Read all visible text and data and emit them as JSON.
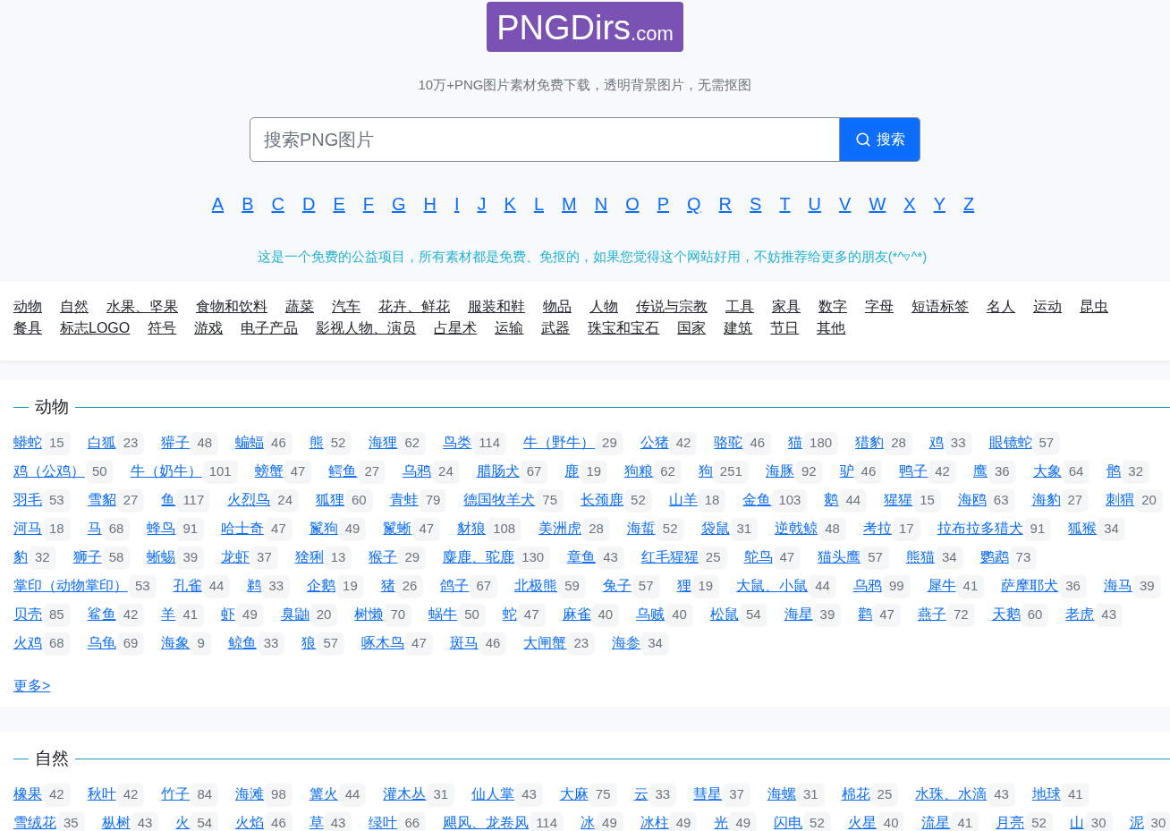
{
  "logo": {
    "name": "PNGDirs",
    "suffix": ".com"
  },
  "tagline": "10万+PNG图片素材免费下载，透明背景图片，无需抠图",
  "search": {
    "placeholder": "搜索PNG图片",
    "button_label": "搜索"
  },
  "letters": [
    "A",
    "B",
    "C",
    "D",
    "E",
    "F",
    "G",
    "H",
    "I",
    "J",
    "K",
    "L",
    "M",
    "N",
    "O",
    "P",
    "Q",
    "R",
    "S",
    "T",
    "U",
    "V",
    "W",
    "X",
    "Y",
    "Z"
  ],
  "notice": "这是一个免费的公益项目，所有素材都是免费、免抠的，如果您觉得这个网站好用，不妨推荐给更多的朋友(*^▿^*)",
  "category_nav": {
    "rows": [
      [
        "动物",
        "自然",
        "水果、坚果",
        "食物和饮料",
        "蔬菜",
        "汽车",
        "花卉、鲜花",
        "服装和鞋",
        "物品",
        "人物",
        "传说与宗教",
        "工具",
        "家具",
        "数字",
        "字母",
        "短语标签",
        "名人",
        "运动",
        "昆虫"
      ],
      [
        "餐具",
        "标志LOGO",
        "符号",
        "游戏",
        "电子产品",
        "影视人物、演员",
        "占星术",
        "运输",
        "武器",
        "珠宝和宝石",
        "国家",
        "建筑",
        "节日",
        "其他"
      ]
    ]
  },
  "sections": [
    {
      "title": "动物",
      "rows": [
        [
          {
            "name": "蟒蛇",
            "count": "15"
          },
          {
            "name": "白狐",
            "count": "23"
          },
          {
            "name": "獾子",
            "count": "48"
          },
          {
            "name": "蝙蝠",
            "count": "46"
          },
          {
            "name": "熊",
            "count": "52"
          },
          {
            "name": "海狸",
            "count": "62"
          },
          {
            "name": "鸟类",
            "count": "114"
          },
          {
            "name": "牛（野牛）",
            "count": "29"
          },
          {
            "name": "公猪",
            "count": "42"
          },
          {
            "name": "骆驼",
            "count": "46"
          },
          {
            "name": "猫",
            "count": "180"
          },
          {
            "name": "猎豹",
            "count": "28"
          },
          {
            "name": "鸡",
            "count": "33"
          },
          {
            "name": "眼镜蛇",
            "count": "57"
          }
        ],
        [
          {
            "name": "鸡（公鸡）",
            "count": "50"
          },
          {
            "name": "牛（奶牛）",
            "count": "101"
          },
          {
            "name": "螃蟹",
            "count": "47"
          },
          {
            "name": "鳄鱼",
            "count": "27"
          },
          {
            "name": "乌鸦",
            "count": "24"
          },
          {
            "name": "腊肠犬",
            "count": "67"
          },
          {
            "name": "鹿",
            "count": "19"
          },
          {
            "name": "狗粮",
            "count": "62"
          },
          {
            "name": "狗",
            "count": "251"
          },
          {
            "name": "海豚",
            "count": "92"
          },
          {
            "name": "驴",
            "count": "46"
          },
          {
            "name": "鸭子",
            "count": "42"
          },
          {
            "name": "鹰",
            "count": "36"
          },
          {
            "name": "大象",
            "count": "64"
          },
          {
            "name": "鹘",
            "count": "32"
          }
        ],
        [
          {
            "name": "羽毛",
            "count": "53"
          },
          {
            "name": "雪貂",
            "count": "27"
          },
          {
            "name": "鱼",
            "count": "117"
          },
          {
            "name": "火烈鸟",
            "count": "24"
          },
          {
            "name": "狐狸",
            "count": "60"
          },
          {
            "name": "青蛙",
            "count": "79"
          },
          {
            "name": "德国牧羊犬",
            "count": "75"
          },
          {
            "name": "长颈鹿",
            "count": "52"
          },
          {
            "name": "山羊",
            "count": "18"
          },
          {
            "name": "金鱼",
            "count": "103"
          },
          {
            "name": "鹅",
            "count": "44"
          },
          {
            "name": "猩猩",
            "count": "15"
          },
          {
            "name": "海鸥",
            "count": "63"
          },
          {
            "name": "海豹",
            "count": "27"
          },
          {
            "name": "刺猬",
            "count": "20"
          }
        ],
        [
          {
            "name": "河马",
            "count": "18"
          },
          {
            "name": "马",
            "count": "68"
          },
          {
            "name": "蜂鸟",
            "count": "91"
          },
          {
            "name": "哈士奇",
            "count": "47"
          },
          {
            "name": "鬣狗",
            "count": "49"
          },
          {
            "name": "鬣蜥",
            "count": "47"
          },
          {
            "name": "豺狼",
            "count": "108"
          },
          {
            "name": "美洲虎",
            "count": "28"
          },
          {
            "name": "海蜇",
            "count": "52"
          },
          {
            "name": "袋鼠",
            "count": "31"
          },
          {
            "name": "逆戟鲸",
            "count": "48"
          },
          {
            "name": "考拉",
            "count": "17"
          },
          {
            "name": "拉布拉多猎犬",
            "count": "91"
          },
          {
            "name": "狐猴",
            "count": "34"
          }
        ],
        [
          {
            "name": "豹",
            "count": "32"
          },
          {
            "name": "狮子",
            "count": "58"
          },
          {
            "name": "蜥蜴",
            "count": "39"
          },
          {
            "name": "龙虾",
            "count": "37"
          },
          {
            "name": "猞猁",
            "count": "13"
          },
          {
            "name": "猴子",
            "count": "29"
          },
          {
            "name": "麋鹿、驼鹿",
            "count": "130"
          },
          {
            "name": "章鱼",
            "count": "43"
          },
          {
            "name": "红毛猩猩",
            "count": "25"
          },
          {
            "name": "鸵鸟",
            "count": "47"
          },
          {
            "name": "猫头鹰",
            "count": "57"
          },
          {
            "name": "熊猫",
            "count": "34"
          },
          {
            "name": "鹦鹉",
            "count": "73"
          }
        ],
        [
          {
            "name": "掌印（动物掌印）",
            "count": "53"
          },
          {
            "name": "孔雀",
            "count": "44"
          },
          {
            "name": "鹈",
            "count": "33"
          },
          {
            "name": "企鹅",
            "count": "19"
          },
          {
            "name": "猪",
            "count": "26"
          },
          {
            "name": "鸽子",
            "count": "67"
          },
          {
            "name": "北极熊",
            "count": "59"
          },
          {
            "name": "兔子",
            "count": "57"
          },
          {
            "name": "狸",
            "count": "19"
          },
          {
            "name": "大鼠、小鼠",
            "count": "44"
          },
          {
            "name": "乌鸦",
            "count": "99"
          },
          {
            "name": "犀牛",
            "count": "41"
          },
          {
            "name": "萨摩耶犬",
            "count": "36"
          },
          {
            "name": "海马",
            "count": "39"
          }
        ],
        [
          {
            "name": "贝壳",
            "count": "85"
          },
          {
            "name": "鲨鱼",
            "count": "42"
          },
          {
            "name": "羊",
            "count": "41"
          },
          {
            "name": "虾",
            "count": "49"
          },
          {
            "name": "臭鼬",
            "count": "20"
          },
          {
            "name": "树懒",
            "count": "70"
          },
          {
            "name": "蜗牛",
            "count": "50"
          },
          {
            "name": "蛇",
            "count": "47"
          },
          {
            "name": "麻雀",
            "count": "40"
          },
          {
            "name": "乌贼",
            "count": "40"
          },
          {
            "name": "松鼠",
            "count": "54"
          },
          {
            "name": "海星",
            "count": "39"
          },
          {
            "name": "鹳",
            "count": "47"
          },
          {
            "name": "燕子",
            "count": "72"
          },
          {
            "name": "天鹅",
            "count": "60"
          },
          {
            "name": "老虎",
            "count": "43"
          }
        ],
        [
          {
            "name": "火鸡",
            "count": "68"
          },
          {
            "name": "乌龟",
            "count": "69"
          },
          {
            "name": "海象",
            "count": "9"
          },
          {
            "name": "鲸鱼",
            "count": "33"
          },
          {
            "name": "狼",
            "count": "57"
          },
          {
            "name": "啄木鸟",
            "count": "47"
          },
          {
            "name": "斑马",
            "count": "46"
          },
          {
            "name": "大闸蟹",
            "count": "23"
          },
          {
            "name": "海参",
            "count": "34"
          }
        ]
      ],
      "more": "更多>"
    },
    {
      "title": "自然",
      "rows": [
        [
          {
            "name": "橡果",
            "count": "42"
          },
          {
            "name": "秋叶",
            "count": "42"
          },
          {
            "name": "竹子",
            "count": "84"
          },
          {
            "name": "海滩",
            "count": "98"
          },
          {
            "name": "篝火",
            "count": "44"
          },
          {
            "name": "灌木丛",
            "count": "31"
          },
          {
            "name": "仙人掌",
            "count": "43"
          },
          {
            "name": "大麻",
            "count": "75"
          },
          {
            "name": "云",
            "count": "33"
          },
          {
            "name": "彗星",
            "count": "37"
          },
          {
            "name": "海螺",
            "count": "31"
          },
          {
            "name": "棉花",
            "count": "25"
          },
          {
            "name": "水珠、水滴",
            "count": "43"
          },
          {
            "name": "地球",
            "count": "41"
          }
        ],
        [
          {
            "name": "雪绒花",
            "count": "35"
          },
          {
            "name": "枞树",
            "count": "43"
          },
          {
            "name": "火",
            "count": "54"
          },
          {
            "name": "火焰",
            "count": "46"
          },
          {
            "name": "草",
            "count": "43"
          },
          {
            "name": "绿叶",
            "count": "66"
          },
          {
            "name": "飓风、龙卷风",
            "count": "114"
          },
          {
            "name": "冰",
            "count": "49"
          },
          {
            "name": "冰柱",
            "count": "49"
          },
          {
            "name": "光",
            "count": "49"
          },
          {
            "name": "闪电",
            "count": "52"
          },
          {
            "name": "火星",
            "count": "40"
          },
          {
            "name": "流星",
            "count": "41"
          },
          {
            "name": "月亮",
            "count": "52"
          },
          {
            "name": "山",
            "count": "30"
          },
          {
            "name": "泥",
            "count": "30"
          }
        ]
      ]
    }
  ]
}
